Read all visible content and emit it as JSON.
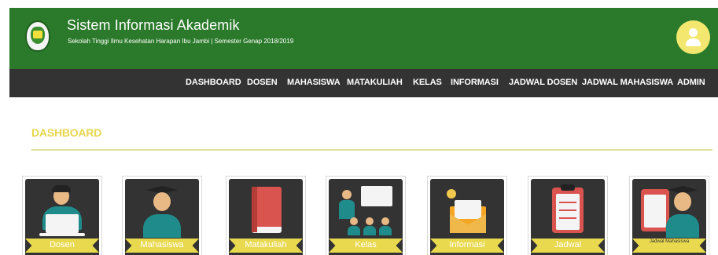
{
  "header": {
    "title": "Sistem Informasi Akademik",
    "subtitle": "Sekolah Tinggi Ilmu Kesehatan Harapan Ibu Jambi | Semester Genap 2018/2019",
    "logo_icon": "institution-logo",
    "avatar_icon": "user-avatar-icon",
    "colors": {
      "header_bg": "#2b7a2b",
      "nav_bg": "#333333",
      "accent": "#e6d64c"
    }
  },
  "nav": {
    "items": [
      {
        "label": "DASHBOARD"
      },
      {
        "label": "DOSEN"
      },
      {
        "label": "MAHASISWA"
      },
      {
        "label": "MATAKULIAH"
      },
      {
        "label": "KELAS"
      },
      {
        "label": "INFORMASI"
      },
      {
        "label": "JADWAL DOSEN"
      },
      {
        "label": "JADWAL MAHASISWA"
      },
      {
        "label": "ADMIN"
      }
    ]
  },
  "main": {
    "heading": "DASHBOARD",
    "cards": [
      {
        "label": "Dosen",
        "icon": "lecturer-icon"
      },
      {
        "label": "Mahasiswa",
        "icon": "graduate-student-icon"
      },
      {
        "label": "Matakuliah",
        "icon": "book-icon"
      },
      {
        "label": "Kelas",
        "icon": "classroom-icon"
      },
      {
        "label": "Informasi",
        "icon": "envelope-info-icon"
      },
      {
        "label": "Jadwal",
        "icon": "clipboard-schedule-icon"
      },
      {
        "label": "Jadwal Mahasiswa",
        "icon": "student-schedule-icon"
      }
    ]
  }
}
